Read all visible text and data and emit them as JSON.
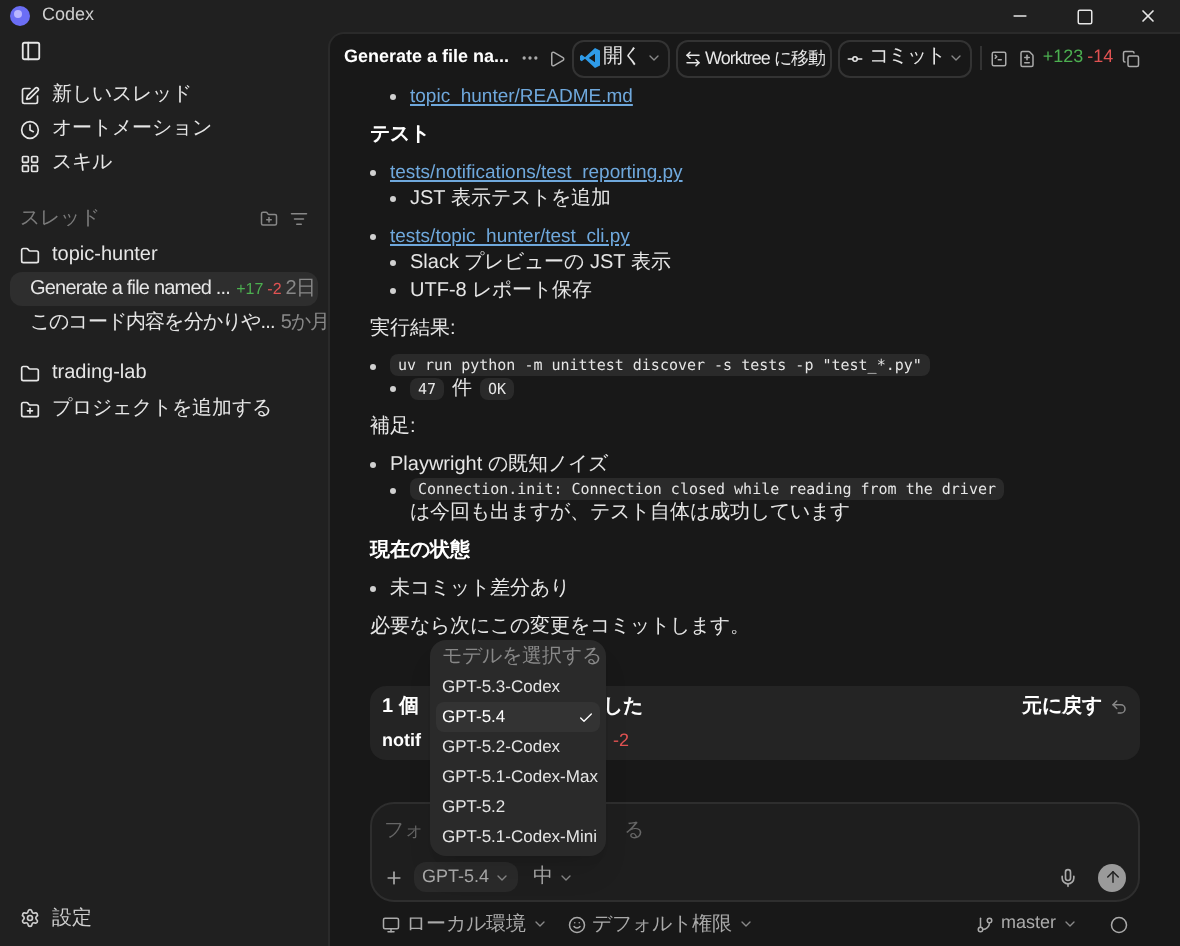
{
  "window": {
    "title": "Codex"
  },
  "sidebar": {
    "nav": [
      {
        "label": "新しいスレッド",
        "kind": "new"
      },
      {
        "label": "オートメーション",
        "kind": "automation"
      },
      {
        "label": "スキル",
        "kind": "skills"
      }
    ],
    "section_title": "スレッド",
    "projects": [
      {
        "name": "topic-hunter",
        "threads": [
          {
            "title": "Generate a file named ...",
            "added": "+17",
            "removed": "-2",
            "age": "2日",
            "selected": true
          },
          {
            "title": "このコード内容を分かりや...",
            "age": "5か月",
            "selected": false
          }
        ]
      },
      {
        "name": "trading-lab"
      }
    ],
    "add_project": "プロジェクトを追加する",
    "settings": "設定"
  },
  "toolbar": {
    "title": "Generate a file na...",
    "open": "開く",
    "worktree": "Worktree に移動",
    "commit": "コミット",
    "added": "+123",
    "removed": "-14"
  },
  "message": [
    {
      "kind": "list",
      "items": [
        {
          "children": [
            {
              "parts": [
                {
                  "kind": "link",
                  "text": "topic_hunter/README.md"
                }
              ]
            }
          ]
        }
      ]
    },
    {
      "kind": "heading",
      "text": "テスト"
    },
    {
      "kind": "list",
      "items": [
        {
          "parts": [
            {
              "kind": "link",
              "text": "tests/notifications/test_reporting.py"
            }
          ],
          "children": [
            {
              "parts": [
                {
                  "kind": "text",
                  "text": "JST 表示テストを追加"
                }
              ]
            }
          ]
        }
      ]
    },
    {
      "kind": "list",
      "items": [
        {
          "parts": [
            {
              "kind": "link",
              "text": "tests/topic_hunter/test_cli.py"
            }
          ],
          "children": [
            {
              "parts": [
                {
                  "kind": "text",
                  "text": "Slack プレビューの JST 表示"
                }
              ]
            },
            {
              "parts": [
                {
                  "kind": "text",
                  "text": "UTF-8 レポート保存"
                }
              ]
            }
          ]
        }
      ]
    },
    {
      "kind": "paragraph",
      "text": "実行結果:"
    },
    {
      "kind": "list",
      "items": [
        {
          "parts": [
            {
              "kind": "code",
              "text": "uv run python -m unittest discover -s tests -p \"test_*.py\""
            }
          ],
          "children": [
            {
              "parts": [
                {
                  "kind": "code",
                  "text": "47"
                },
                {
                  "kind": "text",
                  "text": "件"
                },
                {
                  "kind": "code",
                  "text": "OK"
                }
              ]
            }
          ]
        }
      ]
    },
    {
      "kind": "paragraph",
      "text": "補足:"
    },
    {
      "kind": "list",
      "items": [
        {
          "parts": [
            {
              "kind": "text",
              "text": "Playwright の既知ノイズ"
            }
          ],
          "children": [
            {
              "parts": [
                {
                  "kind": "code",
                  "text": "Connection.init: Connection closed while reading from the driver"
                },
                {
                  "kind": "text",
                  "text": "は今回も出ますが、テスト自体は成功しています"
                }
              ]
            }
          ]
        }
      ]
    },
    {
      "kind": "heading",
      "text": "現在の状態"
    },
    {
      "kind": "list",
      "items": [
        {
          "parts": [
            {
              "kind": "text",
              "text": "未コミット差分あり"
            }
          ]
        }
      ]
    },
    {
      "kind": "paragraph",
      "text": "必要なら次にこの変更をコミットします。"
    }
  ],
  "changes": {
    "left": "1 個",
    "right": "した",
    "undo": "元に戻す",
    "file": "notif",
    "removed": "-2"
  },
  "model_menu": {
    "title": "モデルを選択する",
    "items": [
      {
        "label": "GPT-5.3-Codex",
        "selected": false
      },
      {
        "label": "GPT-5.4",
        "selected": true
      },
      {
        "label": "GPT-5.2-Codex",
        "selected": false
      },
      {
        "label": "GPT-5.1-Codex-Max",
        "selected": false
      },
      {
        "label": "GPT-5.2",
        "selected": false
      },
      {
        "label": "GPT-5.1-Codex-Mini",
        "selected": false
      }
    ]
  },
  "composer": {
    "placeholder_start": "フォ",
    "placeholder_end": "る",
    "model": "GPT-5.4",
    "effort": "中"
  },
  "footer": {
    "environment": "ローカル環境",
    "permissions": "デフォルト権限",
    "branch": "master"
  }
}
